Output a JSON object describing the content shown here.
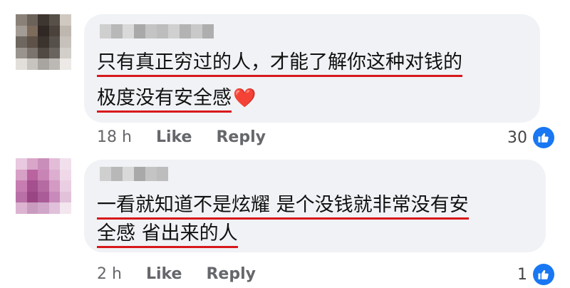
{
  "comments": [
    {
      "line1": "只有真正穷过的人，才能了解你这种对钱的",
      "line2": "极度没有安全感",
      "heart": "❤️",
      "time": "18 h",
      "like": "Like",
      "reply": "Reply",
      "reactions": "30",
      "avatar_colors": [
        "#8a8178",
        "#6b625a",
        "#3d3530",
        "#575049",
        "#cfc9c2",
        "#a39c95",
        "#7d6b5c",
        "#2f2824",
        "#4a423b",
        "#bdb7b0",
        "#6e6760",
        "#5d5148",
        "#3b332d",
        "#56504a",
        "#c6c1bb",
        "#9a948e",
        "#7b746e",
        "#514a44",
        "#6a645f",
        "#d2cec9",
        "#e2dfdb",
        "#c7c3bf",
        "#a8a49f",
        "#bcb8b3",
        "#ece9e6"
      ],
      "name_colors": [
        "#cfcfcf",
        "#b8b8b8",
        "#d9d9d9",
        "#a9a9a9",
        "#c4c4c4",
        "#bdbdbd",
        "#d0d0d0",
        "#b3b3b3",
        "#c9c9c9",
        "#aeaeae"
      ]
    },
    {
      "line1": "一看就知道不是炫耀 是个没钱就非常没有安",
      "line2": "全感 省出来的人",
      "time": "2 h",
      "like": "Like",
      "reply": "Reply",
      "reactions": "1",
      "avatar_colors": [
        "#e8c9df",
        "#d9a5c9",
        "#c98fba",
        "#e3bcd7",
        "#f1e0ec",
        "#d7a0c6",
        "#b9639f",
        "#c984b6",
        "#dcaed0",
        "#efd9e8",
        "#c77db2",
        "#a44f8e",
        "#b56aa2",
        "#d39ac3",
        "#e9cfe1",
        "#b970a6",
        "#9a4584",
        "#aa5c98",
        "#c88abb",
        "#e2c2da",
        "#dcb4d1",
        "#c99bbf",
        "#d0a7c8",
        "#e0c0da",
        "#f3e6ef"
      ],
      "name_colors": [
        "#cfcfcf",
        "#b8b8b8",
        "#d9d9d9",
        "#a9a9a9",
        "#c4c4c4",
        "#bdbdbd"
      ]
    }
  ]
}
